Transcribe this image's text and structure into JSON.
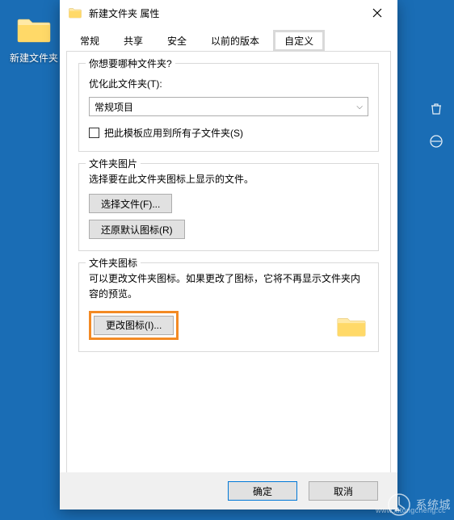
{
  "desktop": {
    "folder_label": "新建文件夹"
  },
  "dialog": {
    "title": "新建文件夹 属性",
    "tabs": [
      "常规",
      "共享",
      "安全",
      "以前的版本",
      "自定义"
    ],
    "active_tab_index": 4,
    "group1": {
      "title": "你想要哪种文件夹?",
      "optimize_label": "优化此文件夹(T):",
      "select_value": "常规项目",
      "checkbox_label": "把此模板应用到所有子文件夹(S)"
    },
    "group2": {
      "title": "文件夹图片",
      "desc": "选择要在此文件夹图标上显示的文件。",
      "choose_file_btn": "选择文件(F)...",
      "restore_btn": "还原默认图标(R)"
    },
    "group3": {
      "title": "文件夹图标",
      "desc": "可以更改文件夹图标。如果更改了图标，它将不再显示文件夹内容的预览。",
      "change_icon_btn": "更改图标(I)..."
    },
    "footer": {
      "ok": "确定",
      "cancel": "取消"
    }
  },
  "watermark": {
    "text": "系统城",
    "sub": "www.xitongcheng.cc"
  }
}
